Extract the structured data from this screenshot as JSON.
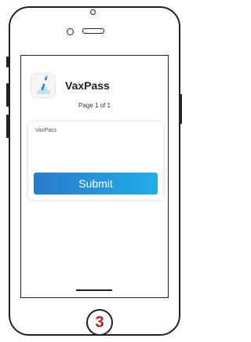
{
  "app": {
    "name": "VaxPass",
    "icon": "vaccine-app-icon"
  },
  "pagination": {
    "label": "Page 1 of 1"
  },
  "form": {
    "field_label": "VaxPass",
    "submit_label": "Submit"
  },
  "step_marker": {
    "value": "3",
    "color": "#b22222"
  },
  "colors": {
    "button_start": "#2d7ac8",
    "button_end": "#1faee8"
  }
}
